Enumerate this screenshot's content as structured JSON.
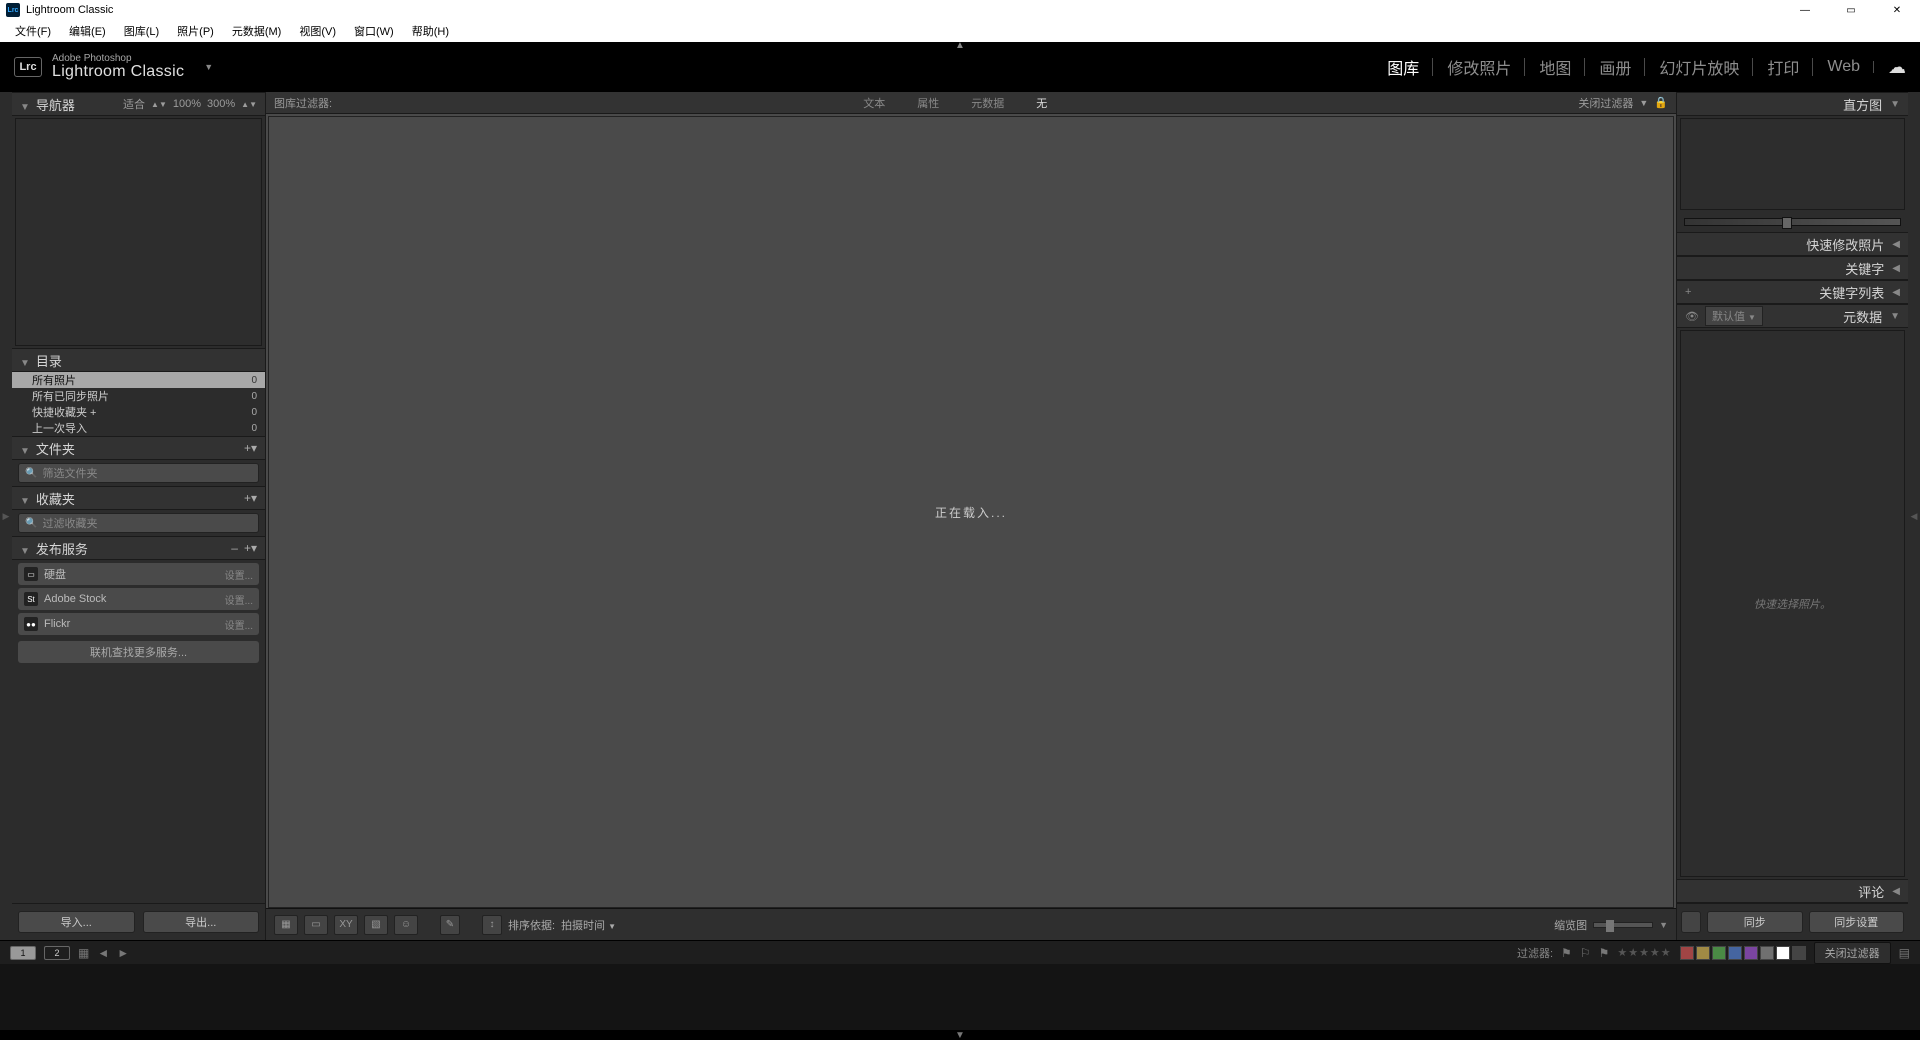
{
  "titlebar": {
    "title": "Lightroom Classic"
  },
  "menu": [
    "文件(F)",
    "编辑(E)",
    "图库(L)",
    "照片(P)",
    "元数据(M)",
    "视图(V)",
    "窗口(W)",
    "帮助(H)"
  ],
  "branding": {
    "line1": "Adobe Photoshop",
    "line2": "Lightroom Classic"
  },
  "modules": [
    "图库",
    "修改照片",
    "地图",
    "画册",
    "幻灯片放映",
    "打印",
    "Web"
  ],
  "active_module": "图库",
  "left": {
    "navigator": {
      "title": "导航器",
      "fit": "适合",
      "z1": "100%",
      "z2": "300%"
    },
    "catalog": {
      "title": "目录",
      "items": [
        {
          "label": "所有照片",
          "count": "0",
          "active": true
        },
        {
          "label": "所有已同步照片",
          "count": "0"
        },
        {
          "label": "快捷收藏夹 +",
          "count": "0"
        },
        {
          "label": "上一次导入",
          "count": "0"
        }
      ]
    },
    "folders": {
      "title": "文件夹",
      "filter_placeholder": "筛选文件夹"
    },
    "collections": {
      "title": "收藏夹",
      "filter_placeholder": "过滤收藏夹"
    },
    "publish": {
      "title": "发布服务",
      "services": [
        {
          "name": "硬盘",
          "set": "设置..."
        },
        {
          "name": "Adobe Stock",
          "set": "设置..."
        },
        {
          "name": "Flickr",
          "set": "设置..."
        }
      ],
      "more": "联机查找更多服务..."
    },
    "import_btn": "导入...",
    "export_btn": "导出..."
  },
  "center": {
    "filter_title": "图库过滤器:",
    "tabs": [
      "文本",
      "属性",
      "元数据",
      "无"
    ],
    "active_tab": "无",
    "close_filter": "关闭过滤器",
    "loading": "正在载入...",
    "sort_label": "排序依据:",
    "sort_value": "拍摄时间",
    "thumb_label": "缩览图"
  },
  "right": {
    "histogram": "直方图",
    "quickdev": "快速修改照片",
    "keywords": "关键字",
    "keyword_list": "关键字列表",
    "metadata": "元数据",
    "metadata_preset": "默认值",
    "metadata_placeholder": "快速选择照片。",
    "comments": "评论",
    "sync": "同步",
    "sync_settings": "同步设置"
  },
  "strip": {
    "filter_label": "过滤器:",
    "close_filter": "关闭过滤器",
    "swatch_colors": [
      "#a04545",
      "#a08a45",
      "#4a8a45",
      "#4565a0",
      "#7a45a0",
      "#707070",
      "#ffffff",
      "#444444"
    ]
  }
}
